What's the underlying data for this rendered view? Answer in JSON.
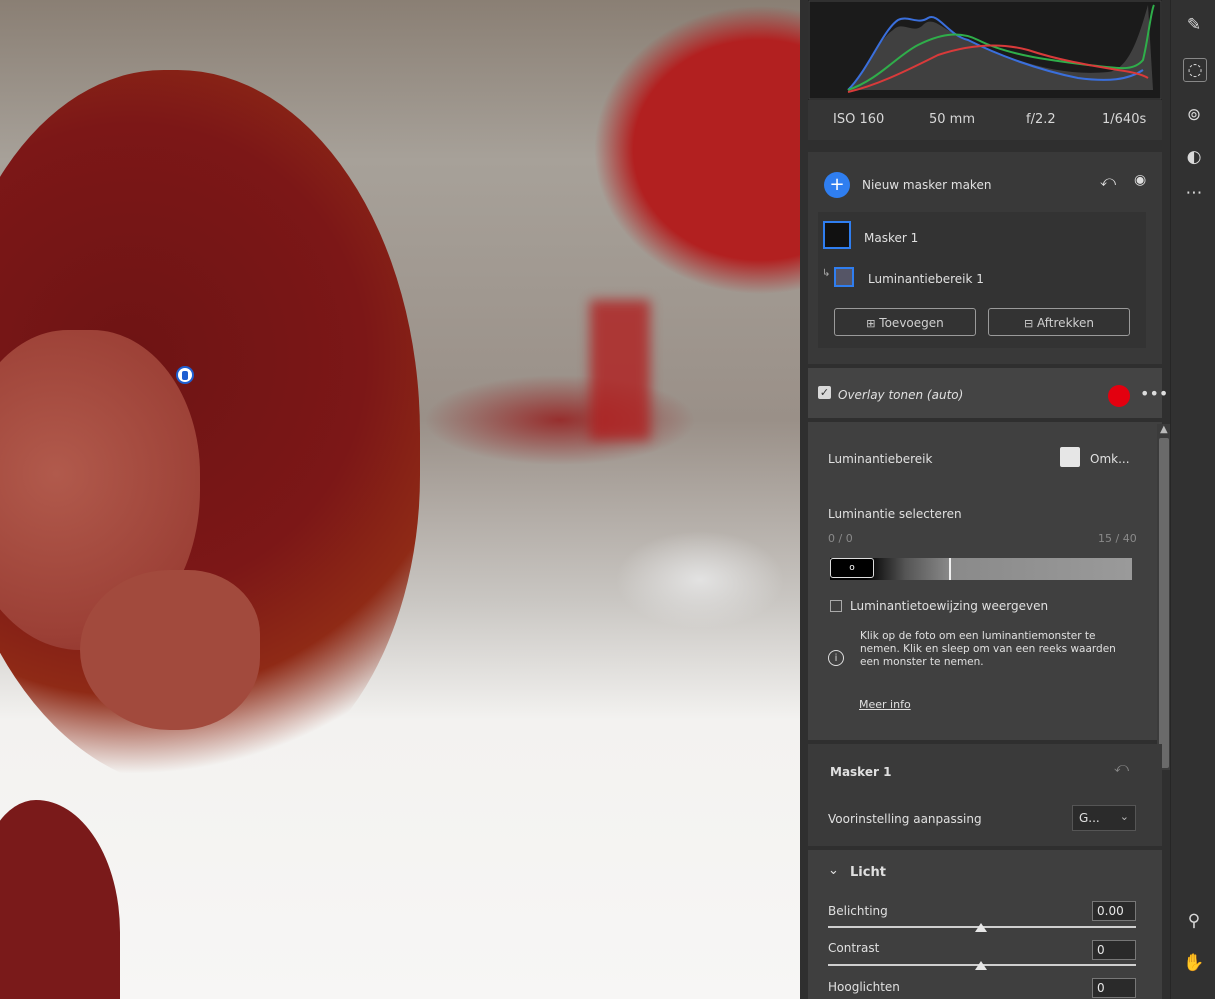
{
  "exif": {
    "iso": "ISO 160",
    "focal": "50 mm",
    "aperture": "f/2.2",
    "shutter": "1/640s"
  },
  "masks": {
    "new_mask_label": "Nieuw masker maken",
    "mask_item": "Masker 1",
    "component_item": "Luminantiebereik 1",
    "add_button": "Toevoegen",
    "subtract_button": "Aftrekken"
  },
  "overlay": {
    "label": "Overlay tonen (auto)",
    "checked": true,
    "color": "#e3000f"
  },
  "luminance": {
    "title": "Luminantiebereik",
    "invert_label": "Omk...",
    "select_label": "Luminantie selecteren",
    "range_left": "0 / 0",
    "range_right": "15 / 40",
    "show_map_label": "Luminantietoewijzing weergeven",
    "info_text": "Klik op de foto om een luminantiemonster te nemen. Klik en sleep om van een reeks waarden een monster te nemen.",
    "more_info": "Meer info"
  },
  "mask_settings": {
    "title": "Masker 1",
    "preset_label": "Voorinstelling aanpassing",
    "preset_value": "G...",
    "section_light": "Licht",
    "sliders": [
      {
        "label": "Belichting",
        "value": "0.00",
        "position": 0.5
      },
      {
        "label": "Contrast",
        "value": "0",
        "position": 0.5
      },
      {
        "label": "Hooglichten",
        "value": "0",
        "position": 0.5
      }
    ]
  },
  "colors": {
    "accent": "#2f7ef0",
    "panel": "#404040"
  }
}
